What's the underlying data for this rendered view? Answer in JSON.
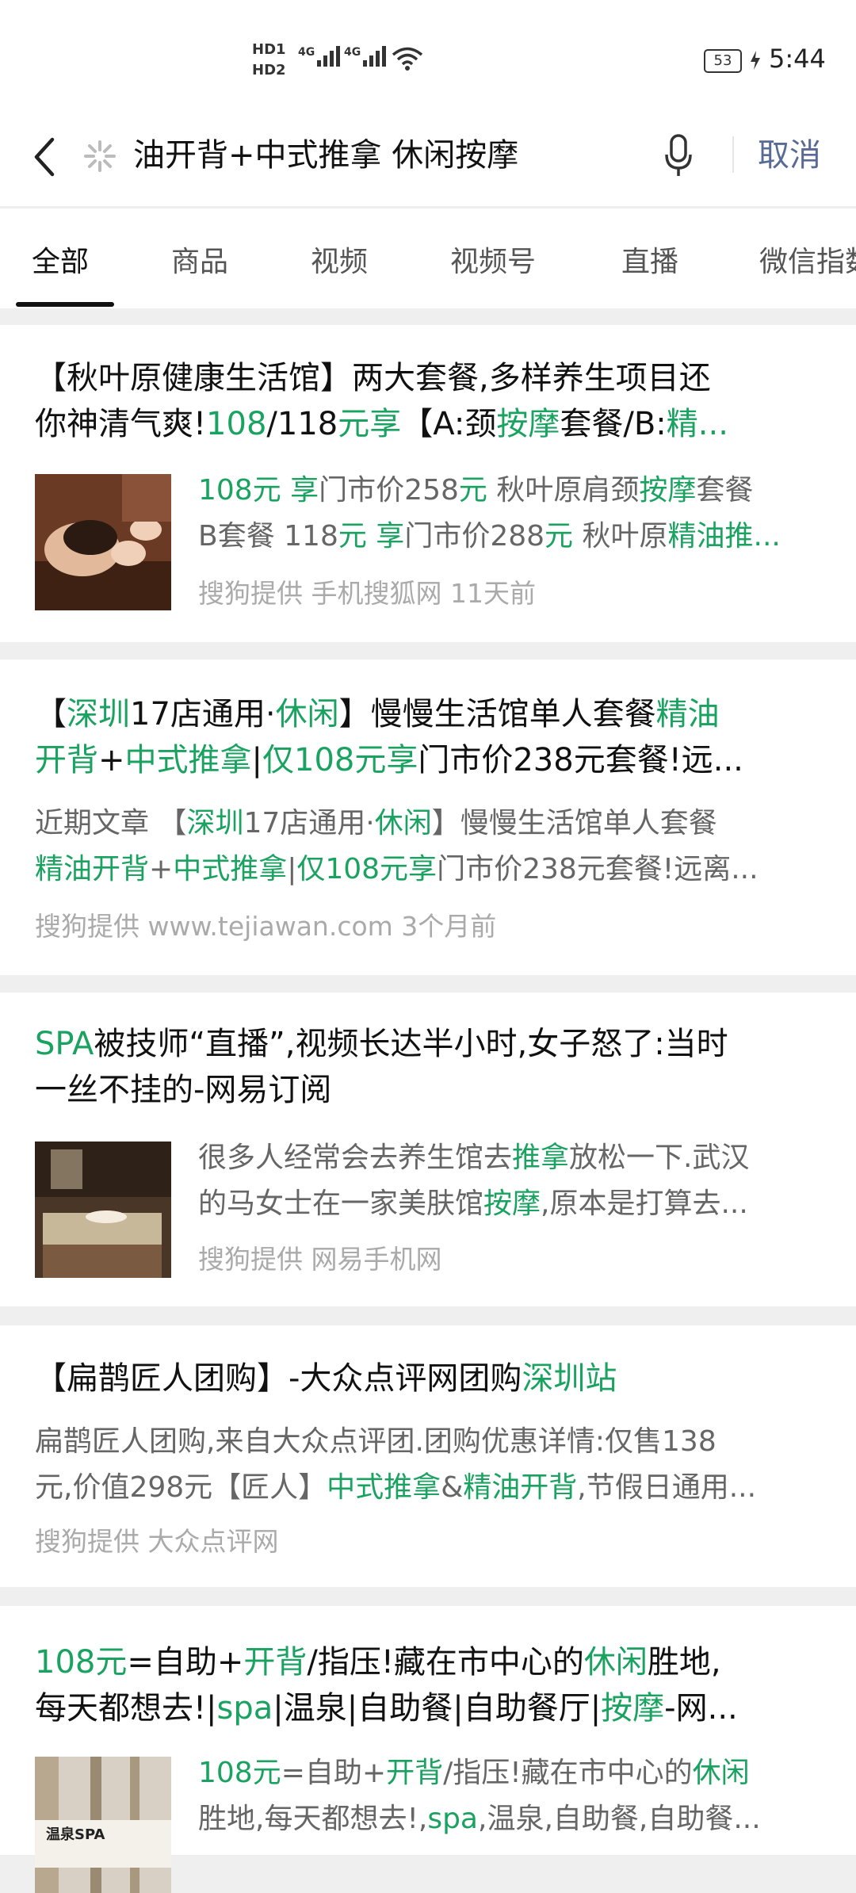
{
  "status_bar": {
    "sim1": "HD1",
    "sim2": "HD2",
    "net1": "4G",
    "net2": "4G",
    "battery": "53",
    "time": "5:44"
  },
  "search": {
    "query": "油开背+中式推拿 休闲按摩",
    "cancel_label": "取消"
  },
  "tabs": [
    "全部",
    "商品",
    "视频",
    "视频号",
    "直播",
    "微信指数"
  ],
  "results": [
    {
      "title_line1": "【秋叶原健康生活馆】两大套餐,多样养生项目还",
      "title_line2_parts": [
        "你神清气爽!",
        "108",
        "/118",
        "元享",
        "【A:颈",
        "按摩",
        "套餐/B:",
        "精..."
      ],
      "body_line1_parts": [
        "108元 享",
        "门市价258",
        "元",
        " 秋叶原肩颈",
        "按摩",
        "套餐"
      ],
      "body_line2_parts": [
        "B套餐 118",
        "元 享",
        "门市价288",
        "元",
        " 秋叶原",
        "精油推..."
      ],
      "meta": "搜狗提供  手机搜狐网   11天前"
    },
    {
      "title_line1_parts": [
        "【",
        "深圳",
        "17店通用·",
        "休闲",
        "】慢慢生活馆单人套餐",
        "精油"
      ],
      "title_line2_parts": [
        "开背",
        "+",
        "中式推拿",
        "|",
        "仅108元享",
        "门市价238元套餐!远..."
      ],
      "body_line1_parts": [
        "近期文章 【",
        "深圳",
        "17店通用·",
        "休闲",
        "】慢慢生活馆单人套餐"
      ],
      "body_line2_parts": [
        "精油开背",
        "+",
        "中式推拿",
        "|",
        "仅108元享",
        "门市价238元套餐!远离..."
      ],
      "meta": "搜狗提供 www.tejiawan.com   3个月前"
    },
    {
      "title_line1_parts": [
        "SPA",
        "被技师“直播”,视频长达半小时,女子怒了:当时"
      ],
      "title_line2": "一丝不挂的-网易订阅",
      "body_line1_parts": [
        "很多人经常会去养生馆去",
        "推拿",
        "放松一下.武汉"
      ],
      "body_line2_parts": [
        "的马女士在一家美肤馆",
        "按摩",
        ",原本是打算去..."
      ],
      "meta": "搜狗提供 网易手机网"
    },
    {
      "title_line1_parts": [
        "【扁鹊匠人团购】-大众点评网团购",
        "深圳站"
      ],
      "body_line1": "扁鹊匠人团购,来自大众点评团.团购优惠详情:仅售138",
      "body_line2_parts": [
        "元,价值298元【匠人】",
        "中式推拿",
        "&",
        "精油开背",
        ",节假日通用..."
      ],
      "meta": "搜狗提供 大众点评网"
    },
    {
      "title_line1_parts": [
        "108元",
        "=自助+",
        "开背",
        "/指压!藏在市中心的",
        "休闲",
        "胜地,"
      ],
      "title_line2_parts": [
        "每天都想去!|",
        "spa",
        "|温泉|自助餐|自助餐厅|",
        "按摩",
        "-网..."
      ],
      "body_line1_parts": [
        "108元",
        "=自助+",
        "开背",
        "/指压!藏在市中心的",
        "休闲"
      ],
      "body_line2_parts": [
        "胜地,每天都想去!,",
        "spa",
        ",温泉,自助餐,自助餐..."
      ],
      "thumb_caption": "温泉SPA"
    }
  ]
}
